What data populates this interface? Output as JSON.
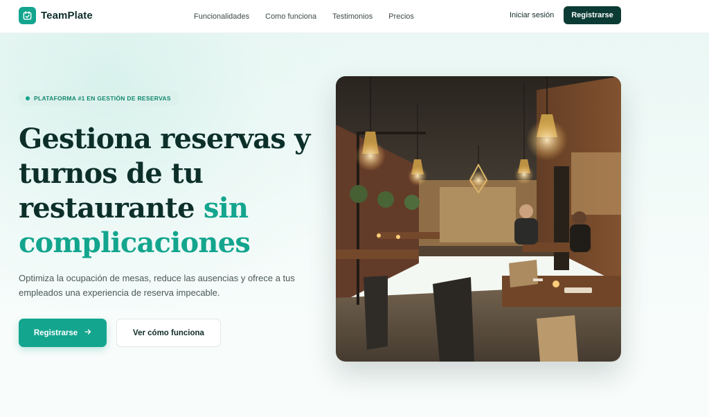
{
  "header": {
    "brand": "TeamPlate",
    "nav": [
      {
        "label": "Funcionalidades"
      },
      {
        "label": "Como funciona"
      },
      {
        "label": "Testimonios"
      },
      {
        "label": "Precios"
      }
    ],
    "login_label": "Iniciar sesión",
    "signup_label": "Registrarse"
  },
  "hero": {
    "badge": "PLATAFORMA #1 EN GESTIÓN DE RESERVAS",
    "title_line1": "Gestiona reservas y",
    "title_line2": "turnos de tu",
    "title_line3": "restaurante",
    "title_accent_1": "sin",
    "title_accent_2": "complicaciones",
    "subtitle": "Optimiza la ocupación de mesas, reduce las ausencias y ofrece a tus empleados una experiencia de reserva impecable.",
    "primary_cta": "Registrarse",
    "primary_cta_icon": "arrow-right-icon",
    "secondary_cta": "Ver cómo funciona"
  },
  "icons": {
    "logo": "calendar-check-icon"
  },
  "colors": {
    "brand": "#13a58e",
    "dark": "#0b3b34",
    "heading": "#0d2f2a"
  }
}
